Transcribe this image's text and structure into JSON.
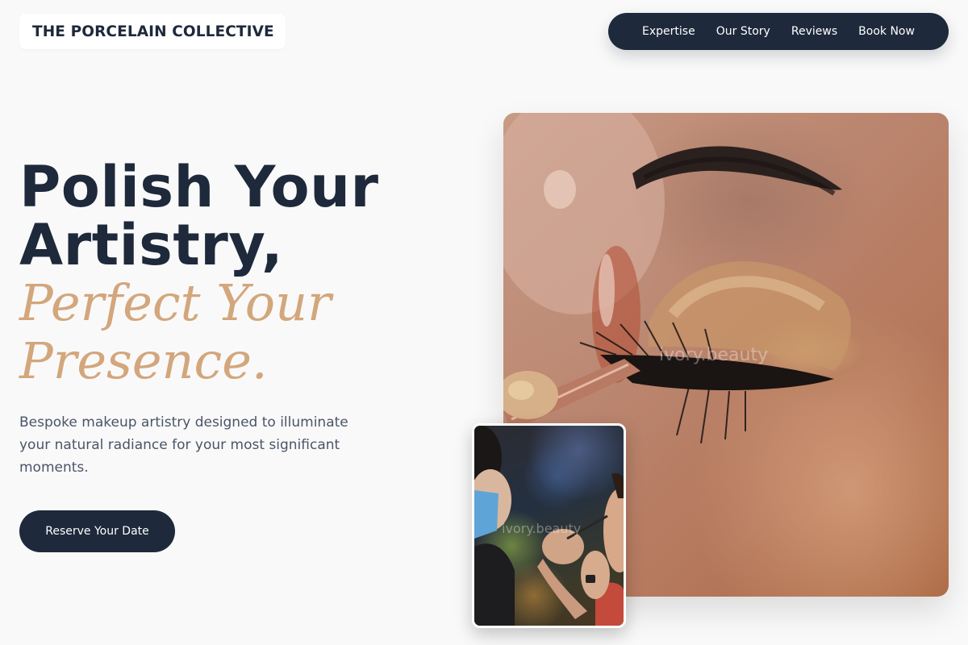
{
  "brand": {
    "name": "THE PORCELAIN COLLECTIVE"
  },
  "nav": {
    "items": [
      {
        "label": "Expertise"
      },
      {
        "label": "Our Story"
      },
      {
        "label": "Reviews"
      },
      {
        "label": "Book Now"
      }
    ]
  },
  "hero": {
    "headline_lines": [
      "Polish Your",
      "Artistry,"
    ],
    "accent_lines": [
      "Perfect Your",
      "Presence."
    ],
    "description": "Bespoke makeup artistry designed to illuminate your natural radiance for your most significant moments.",
    "cta_label": "Reserve Your Date"
  },
  "images": {
    "main": {
      "subject": "close-up of false eyelash application on golden-shimmer eyelid",
      "watermark": "ivory.beauty"
    },
    "inset": {
      "subject": "masked makeup artist applying eyeliner to a client",
      "watermark": "ivory.beauty"
    }
  },
  "colors": {
    "primary": "#1e293b",
    "accent": "#d3a67c",
    "background": "#f9f9f9",
    "body_text": "#4a5568"
  }
}
